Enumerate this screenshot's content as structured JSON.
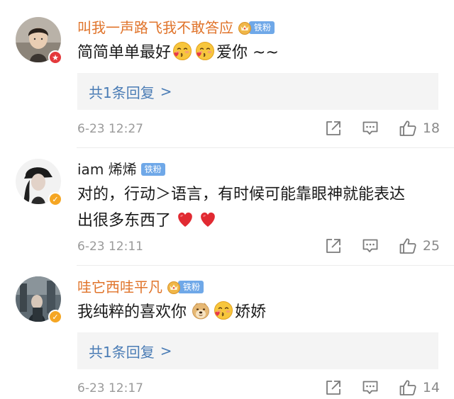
{
  "comments": [
    {
      "username": "叫我一声路飞我不敢答应",
      "username_color": "#e0742b",
      "fan_label": "铁粉",
      "text_parts": [
        "简简单单最好",
        "爱你 ~~"
      ],
      "reply_label": "共1条回复",
      "reply_arrow": ">",
      "time": "6-23 12:27",
      "likes": "18",
      "badge": "red-star"
    },
    {
      "username": "iam 烯烯",
      "username_color": "#222222",
      "fan_label": "铁粉",
      "text_line1": "对的，行动＞语言，有时候可能靠眼神就能表达",
      "text_line2": "出很多东西了",
      "time": "6-23 12:11",
      "likes": "25",
      "badge": "verified-yellow"
    },
    {
      "username": "哇它西哇平凡",
      "username_color": "#e0742b",
      "fan_label": "铁粉",
      "text_parts": [
        "我纯粹的喜欢你",
        "娇娇"
      ],
      "reply_label": "共1条回复",
      "reply_arrow": ">",
      "time": "6-23 12:17",
      "likes": "14",
      "badge": "verified-yellow"
    }
  ],
  "colors": {
    "link_blue": "#4a7cb5",
    "fan_tag_blue": "#6fa8e8",
    "meta_gray": "#9a9a9a"
  }
}
